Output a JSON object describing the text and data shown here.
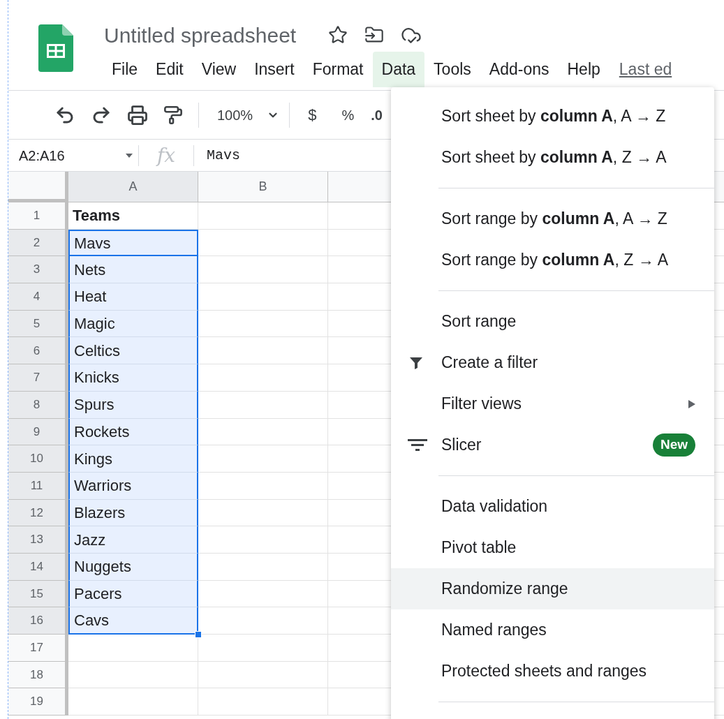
{
  "title": "Untitled spreadsheet",
  "menubar": [
    {
      "label": "File",
      "selected": false
    },
    {
      "label": "Edit",
      "selected": false
    },
    {
      "label": "View",
      "selected": false
    },
    {
      "label": "Insert",
      "selected": false
    },
    {
      "label": "Format",
      "selected": false
    },
    {
      "label": "Data",
      "selected": true
    },
    {
      "label": "Tools",
      "selected": false
    },
    {
      "label": "Add-ons",
      "selected": false
    },
    {
      "label": "Help",
      "selected": false
    }
  ],
  "last_edit": "Last ed",
  "toolbar": {
    "zoom": "100%",
    "currency": "$",
    "percent": "%",
    "decimal": ".0"
  },
  "formula_bar": {
    "name_box": "A2:A16",
    "fx": "fx",
    "value": "Mavs"
  },
  "columns": [
    {
      "label": "A",
      "selected": true
    },
    {
      "label": "B",
      "selected": false
    }
  ],
  "rows": [
    {
      "number": "1",
      "selected": false,
      "active": false,
      "value": "Teams",
      "bold": true
    },
    {
      "number": "2",
      "selected": true,
      "active": true,
      "value": "Mavs",
      "bold": false
    },
    {
      "number": "3",
      "selected": true,
      "active": false,
      "value": "Nets",
      "bold": false
    },
    {
      "number": "4",
      "selected": true,
      "active": false,
      "value": "Heat",
      "bold": false
    },
    {
      "number": "5",
      "selected": true,
      "active": false,
      "value": "Magic",
      "bold": false
    },
    {
      "number": "6",
      "selected": true,
      "active": false,
      "value": "Celtics",
      "bold": false
    },
    {
      "number": "7",
      "selected": true,
      "active": false,
      "value": "Knicks",
      "bold": false
    },
    {
      "number": "8",
      "selected": true,
      "active": false,
      "value": "Spurs",
      "bold": false
    },
    {
      "number": "9",
      "selected": true,
      "active": false,
      "value": "Rockets",
      "bold": false
    },
    {
      "number": "10",
      "selected": true,
      "active": false,
      "value": "Kings",
      "bold": false
    },
    {
      "number": "11",
      "selected": true,
      "active": false,
      "value": "Warriors",
      "bold": false
    },
    {
      "number": "12",
      "selected": true,
      "active": false,
      "value": "Blazers",
      "bold": false
    },
    {
      "number": "13",
      "selected": true,
      "active": false,
      "value": "Jazz",
      "bold": false
    },
    {
      "number": "14",
      "selected": true,
      "active": false,
      "value": "Nuggets",
      "bold": false
    },
    {
      "number": "15",
      "selected": true,
      "active": false,
      "value": "Pacers",
      "bold": false
    },
    {
      "number": "16",
      "selected": true,
      "active": false,
      "value": "Cavs",
      "bold": false
    },
    {
      "number": "17",
      "selected": false,
      "active": false
    },
    {
      "number": "18",
      "selected": false,
      "active": false
    },
    {
      "number": "19",
      "selected": false,
      "active": false
    }
  ],
  "data_menu": [
    {
      "kind": "item",
      "label": "Sort sheet by **column A**, A → Z",
      "highlighted": false
    },
    {
      "kind": "item",
      "label": "Sort sheet by **column A**, Z → A",
      "highlighted": false
    },
    {
      "kind": "divider"
    },
    {
      "kind": "item",
      "label": "Sort range by **column A**, A → Z",
      "highlighted": false
    },
    {
      "kind": "item",
      "label": "Sort range by **column A**, Z → A",
      "highlighted": false
    },
    {
      "kind": "divider"
    },
    {
      "kind": "item",
      "label": "Sort range",
      "highlighted": false
    },
    {
      "kind": "filter",
      "label": "Create a filter",
      "highlighted": false
    },
    {
      "kind": "item",
      "label": "Filter views",
      "submenu": true,
      "highlighted": false
    },
    {
      "kind": "slicer",
      "label": "Slicer",
      "badge": "New",
      "highlighted": false
    },
    {
      "kind": "divider"
    },
    {
      "kind": "item",
      "label": "Data validation",
      "highlighted": false
    },
    {
      "kind": "item",
      "label": "Pivot table",
      "highlighted": false
    },
    {
      "kind": "item",
      "label": "Randomize range",
      "highlighted": true
    },
    {
      "kind": "item",
      "label": "Named ranges",
      "highlighted": false
    },
    {
      "kind": "item",
      "label": "Protected sheets and ranges",
      "highlighted": false
    },
    {
      "kind": "divider"
    }
  ]
}
